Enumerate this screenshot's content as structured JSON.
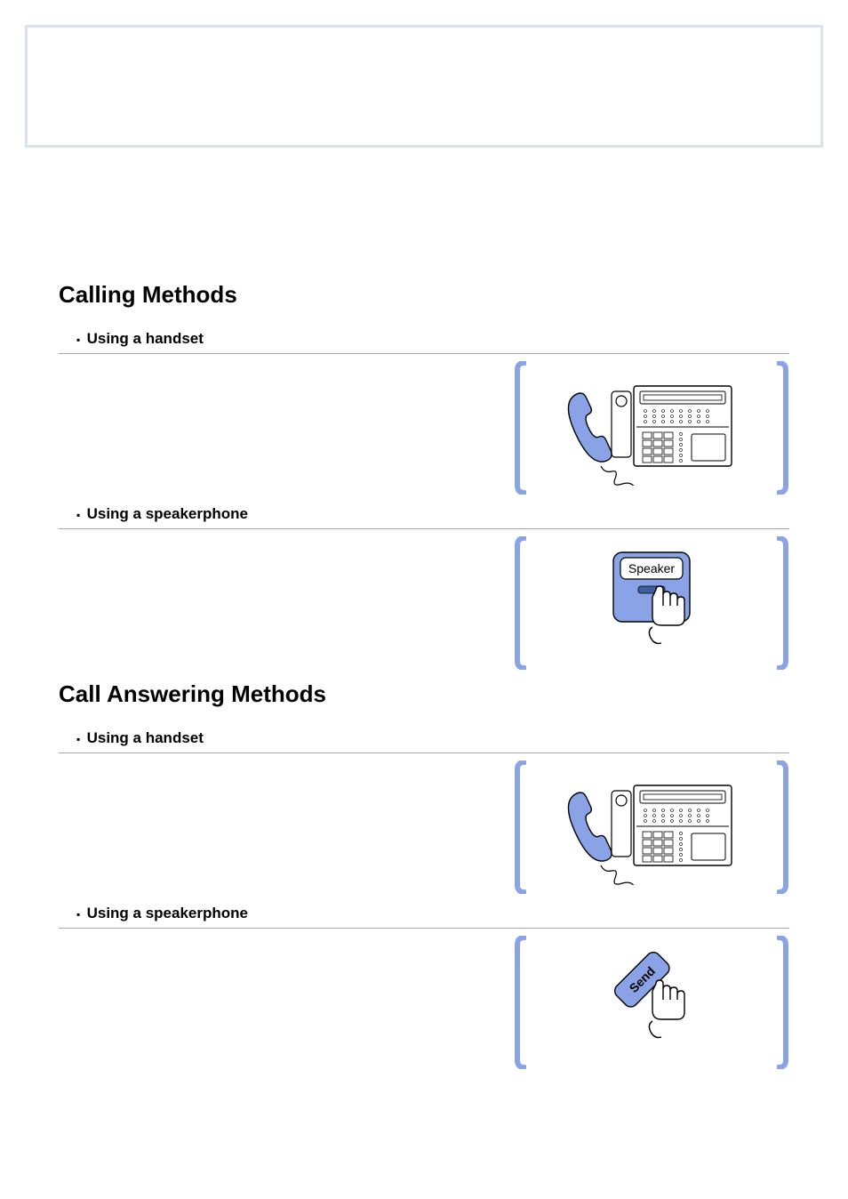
{
  "sections": [
    {
      "title": "Calling Methods",
      "items": [
        {
          "label": "Using a handset",
          "illustration": "phone-handset"
        },
        {
          "label": "Using a speakerphone",
          "illustration": "speaker-button"
        }
      ]
    },
    {
      "title": "Call Answering Methods",
      "items": [
        {
          "label": "Using a handset",
          "illustration": "phone-handset"
        },
        {
          "label": "Using a speakerphone",
          "illustration": "send-button"
        }
      ]
    }
  ],
  "icon_text": {
    "speaker": "Speaker",
    "send": "Send"
  }
}
